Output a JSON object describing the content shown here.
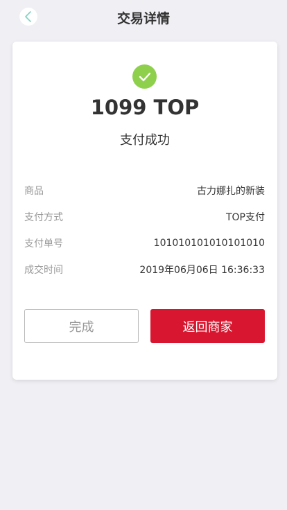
{
  "header": {
    "title": "交易详情",
    "back_icon": "chevron-left-icon"
  },
  "result": {
    "amount": "1099 TOP",
    "status": "支付成功",
    "icon": "check-circle-icon",
    "icon_color": "#8ed04c"
  },
  "details": [
    {
      "label": "商品",
      "value": "古力娜扎的新装"
    },
    {
      "label": "支付方式",
      "value": "TOP支付"
    },
    {
      "label": "支付单号",
      "value": "101010101010101010"
    },
    {
      "label": "成交时间",
      "value": "2019年06月06日 16:36:33"
    }
  ],
  "actions": {
    "done_label": "完成",
    "return_label": "返回商家",
    "accent_color": "#d9162f"
  }
}
